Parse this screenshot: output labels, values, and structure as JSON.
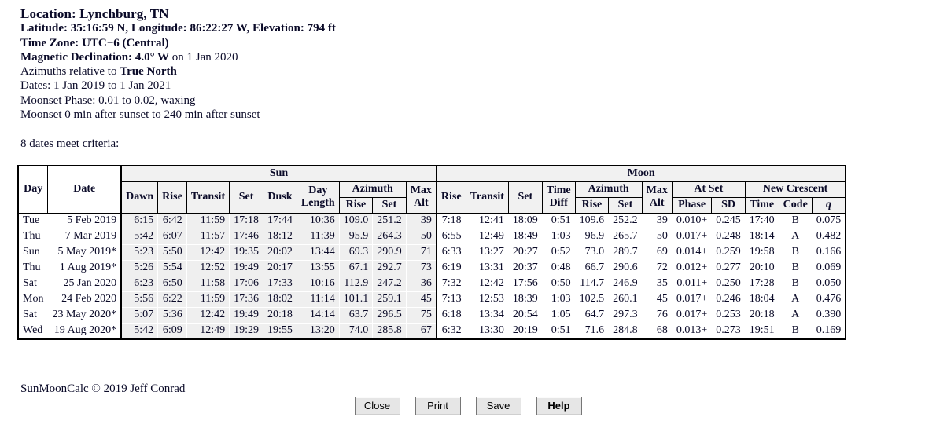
{
  "header": {
    "location_label": "Location:",
    "location_value": "Lynchburg, TN",
    "latitude_label": "Latitude:",
    "latitude_value": "35:16:59 N",
    "longitude_label": "Longitude:",
    "longitude_value": "86:22:27 W",
    "elevation_label": "Elevation:",
    "elevation_value": "794 ft",
    "timezone_label": "Time Zone:",
    "timezone_value": "UTC−6 (Central)",
    "declination_label": "Magnetic Declination:",
    "declination_value": "4.0° W",
    "declination_date": "on 1 Jan 2020",
    "azimuths_prefix": "Azimuths relative to",
    "azimuths_ref": "True North",
    "dates_line": "Dates: 1 Jan 2019 to 1 Jan 2021",
    "moonset_phase_line": "Moonset Phase: 0.01 to 0.02, waxing",
    "moonset_window_line": "Moonset 0 min after sunset to 240 min after sunset"
  },
  "criteria_line": "8 dates meet criteria:",
  "table": {
    "group_headers": {
      "sun": "Sun",
      "moon": "Moon"
    },
    "columns": {
      "day": "Day",
      "date": "Date",
      "sun_dawn": "Dawn",
      "sun_rise": "Rise",
      "sun_transit": "Transit",
      "sun_set": "Set",
      "sun_dusk": "Dusk",
      "sun_day_length_l1": "Day",
      "sun_day_length_l2": "Length",
      "sun_azimuth": "Azimuth",
      "sun_az_rise": "Rise",
      "sun_az_set": "Set",
      "sun_max_alt_l1": "Max",
      "sun_max_alt_l2": "Alt",
      "moon_rise": "Rise",
      "moon_transit": "Transit",
      "moon_set": "Set",
      "moon_time_diff_l1": "Time",
      "moon_time_diff_l2": "Diff",
      "moon_azimuth": "Azimuth",
      "moon_az_rise": "Rise",
      "moon_az_set": "Set",
      "moon_max_alt_l1": "Max",
      "moon_max_alt_l2": "Alt",
      "moon_at_set": "At Set",
      "moon_phase": "Phase",
      "moon_sd": "SD",
      "new_crescent": "New Crescent",
      "nc_time": "Time",
      "nc_code": "Code",
      "nc_q": "q"
    },
    "rows": [
      {
        "day": "Tue",
        "date": "5 Feb 2019",
        "sun_dawn": "6:15",
        "sun_rise": "6:42",
        "sun_transit": "11:59",
        "sun_set": "17:18",
        "sun_dusk": "17:44",
        "sun_day_length": "10:36",
        "sun_az_rise": "109.0",
        "sun_az_set": "251.2",
        "sun_max_alt": "39",
        "moon_rise": "7:18",
        "moon_transit": "12:41",
        "moon_set": "18:09",
        "moon_time_diff": "0:51",
        "moon_az_rise": "109.6",
        "moon_az_set": "252.2",
        "moon_max_alt": "39",
        "moon_phase": "0.010+",
        "moon_sd": "0.245",
        "nc_time": "17:40",
        "nc_code": "B",
        "nc_q": "0.075"
      },
      {
        "day": "Thu",
        "date": "7 Mar 2019",
        "sun_dawn": "5:42",
        "sun_rise": "6:07",
        "sun_transit": "11:57",
        "sun_set": "17:46",
        "sun_dusk": "18:12",
        "sun_day_length": "11:39",
        "sun_az_rise": "95.9",
        "sun_az_set": "264.3",
        "sun_max_alt": "50",
        "moon_rise": "6:55",
        "moon_transit": "12:49",
        "moon_set": "18:49",
        "moon_time_diff": "1:03",
        "moon_az_rise": "96.9",
        "moon_az_set": "265.7",
        "moon_max_alt": "50",
        "moon_phase": "0.017+",
        "moon_sd": "0.248",
        "nc_time": "18:14",
        "nc_code": "A",
        "nc_q": "0.482"
      },
      {
        "day": "Sun",
        "date": "5 May 2019*",
        "sun_dawn": "5:23",
        "sun_rise": "5:50",
        "sun_transit": "12:42",
        "sun_set": "19:35",
        "sun_dusk": "20:02",
        "sun_day_length": "13:44",
        "sun_az_rise": "69.3",
        "sun_az_set": "290.9",
        "sun_max_alt": "71",
        "moon_rise": "6:33",
        "moon_transit": "13:27",
        "moon_set": "20:27",
        "moon_time_diff": "0:52",
        "moon_az_rise": "73.0",
        "moon_az_set": "289.7",
        "moon_max_alt": "69",
        "moon_phase": "0.014+",
        "moon_sd": "0.259",
        "nc_time": "19:58",
        "nc_code": "B",
        "nc_q": "0.166"
      },
      {
        "day": "Thu",
        "date": "1 Aug 2019*",
        "sun_dawn": "5:26",
        "sun_rise": "5:54",
        "sun_transit": "12:52",
        "sun_set": "19:49",
        "sun_dusk": "20:17",
        "sun_day_length": "13:55",
        "sun_az_rise": "67.1",
        "sun_az_set": "292.7",
        "sun_max_alt": "73",
        "moon_rise": "6:19",
        "moon_transit": "13:31",
        "moon_set": "20:37",
        "moon_time_diff": "0:48",
        "moon_az_rise": "66.7",
        "moon_az_set": "290.6",
        "moon_max_alt": "72",
        "moon_phase": "0.012+",
        "moon_sd": "0.277",
        "nc_time": "20:10",
        "nc_code": "B",
        "nc_q": "0.069"
      },
      {
        "day": "Sat",
        "date": "25 Jan 2020",
        "sun_dawn": "6:23",
        "sun_rise": "6:50",
        "sun_transit": "11:58",
        "sun_set": "17:06",
        "sun_dusk": "17:33",
        "sun_day_length": "10:16",
        "sun_az_rise": "112.9",
        "sun_az_set": "247.2",
        "sun_max_alt": "36",
        "moon_rise": "7:32",
        "moon_transit": "12:42",
        "moon_set": "17:56",
        "moon_time_diff": "0:50",
        "moon_az_rise": "114.7",
        "moon_az_set": "246.9",
        "moon_max_alt": "35",
        "moon_phase": "0.011+",
        "moon_sd": "0.250",
        "nc_time": "17:28",
        "nc_code": "B",
        "nc_q": "0.050"
      },
      {
        "day": "Mon",
        "date": "24 Feb 2020",
        "sun_dawn": "5:56",
        "sun_rise": "6:22",
        "sun_transit": "11:59",
        "sun_set": "17:36",
        "sun_dusk": "18:02",
        "sun_day_length": "11:14",
        "sun_az_rise": "101.1",
        "sun_az_set": "259.1",
        "sun_max_alt": "45",
        "moon_rise": "7:13",
        "moon_transit": "12:53",
        "moon_set": "18:39",
        "moon_time_diff": "1:03",
        "moon_az_rise": "102.5",
        "moon_az_set": "260.1",
        "moon_max_alt": "45",
        "moon_phase": "0.017+",
        "moon_sd": "0.246",
        "nc_time": "18:04",
        "nc_code": "A",
        "nc_q": "0.476"
      },
      {
        "day": "Sat",
        "date": "23 May 2020*",
        "sun_dawn": "5:07",
        "sun_rise": "5:36",
        "sun_transit": "12:42",
        "sun_set": "19:49",
        "sun_dusk": "20:18",
        "sun_day_length": "14:14",
        "sun_az_rise": "63.7",
        "sun_az_set": "296.5",
        "sun_max_alt": "75",
        "moon_rise": "6:18",
        "moon_transit": "13:34",
        "moon_set": "20:54",
        "moon_time_diff": "1:05",
        "moon_az_rise": "64.7",
        "moon_az_set": "297.3",
        "moon_max_alt": "76",
        "moon_phase": "0.017+",
        "moon_sd": "0.253",
        "nc_time": "20:18",
        "nc_code": "A",
        "nc_q": "0.390"
      },
      {
        "day": "Wed",
        "date": "19 Aug 2020*",
        "sun_dawn": "5:42",
        "sun_rise": "6:09",
        "sun_transit": "12:49",
        "sun_set": "19:29",
        "sun_dusk": "19:55",
        "sun_day_length": "13:20",
        "sun_az_rise": "74.0",
        "sun_az_set": "285.8",
        "sun_max_alt": "67",
        "moon_rise": "6:32",
        "moon_transit": "13:30",
        "moon_set": "20:19",
        "moon_time_diff": "0:51",
        "moon_az_rise": "71.6",
        "moon_az_set": "284.8",
        "moon_max_alt": "68",
        "moon_phase": "0.013+",
        "moon_sd": "0.273",
        "nc_time": "19:51",
        "nc_code": "B",
        "nc_q": "0.169"
      }
    ]
  },
  "footer": {
    "copyright": "SunMoonCalc © 2019 Jeff Conrad",
    "buttons": [
      {
        "label": "Close",
        "name": "close-button",
        "default": false
      },
      {
        "label": "Print",
        "name": "print-button",
        "default": false
      },
      {
        "label": "Save",
        "name": "save-button",
        "default": false
      },
      {
        "label": "Help",
        "name": "help-button",
        "default": true
      }
    ]
  }
}
